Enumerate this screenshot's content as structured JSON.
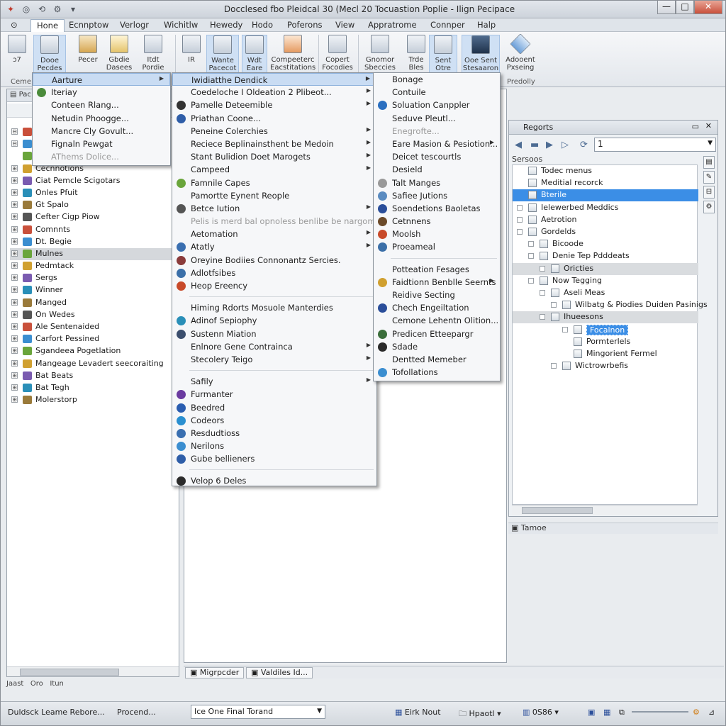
{
  "window": {
    "title": "Docclesed fbo Pleidcal 30 (Mecl 20 Tocuastion Poplie - Ilign Pecipace",
    "controls": {
      "minimize": "—",
      "maximize": "□",
      "close": "✕"
    }
  },
  "quick_access": [
    "◐",
    "◎",
    "⟲",
    "⚙",
    "▾"
  ],
  "menubar": {
    "tabs": [
      "Hone",
      "Ecnnptow",
      "Verlogr",
      "Wichitlw",
      "Hewedy",
      "Hodo",
      "Poferons",
      "View",
      "Appratrome",
      "Connper",
      "Halp"
    ],
    "active_index": 0
  },
  "ribbon": {
    "buttons": [
      {
        "label": "ɔ7",
        "icon": "paste-icon"
      },
      {
        "label": "Dooe Pecdes",
        "icon": "document-icon"
      },
      {
        "label": "Pecer",
        "icon": "database-icon"
      },
      {
        "label": "Gbdie Dasees",
        "icon": "triangle-icon"
      },
      {
        "label": "Itdt Pordie",
        "icon": "grid-icon"
      },
      {
        "label": "IR",
        "icon": "ruler-icon"
      },
      {
        "label": "Wante Pacecot",
        "icon": "page-icon"
      },
      {
        "label": "Wdt Eare",
        "icon": "camera-icon"
      },
      {
        "label": "Compeeterc Eacstitations",
        "icon": "stack-icon"
      },
      {
        "label": "Copert Focodies",
        "icon": "export-icon"
      },
      {
        "label": "Gnomor Sbeccies",
        "icon": "pen-icon"
      },
      {
        "label": "Trde Bles",
        "icon": "tools-icon"
      },
      {
        "label": "Sent Otre",
        "icon": "sheet-icon"
      },
      {
        "label": "Ooe Sent Stesaaron",
        "icon": "monitor-icon"
      },
      {
        "label": "Adooent Pxseing",
        "icon": "diamond-icon"
      }
    ],
    "groups": [
      "Ceme",
      "Predolly"
    ]
  },
  "left_pane": {
    "header": "Pac",
    "tree": [
      {
        "label": "Mancre Cly Govult...",
        "exp": "⊟"
      },
      {
        "label": "Fignaln Pewgat",
        "exp": "⊟"
      },
      {
        "label": "AThems Dolice...",
        "exp": ""
      },
      {
        "label": "Cecnnotions",
        "exp": "⊞"
      },
      {
        "label": "Ciat Pemcle Scigotars",
        "exp": "⊞"
      },
      {
        "label": "Onles Pfuit",
        "exp": "⊞"
      },
      {
        "label": "Gt Spalo",
        "exp": "⊞"
      },
      {
        "label": "Cefter Cigp Piow",
        "exp": "⊞"
      },
      {
        "label": "Comnnts",
        "exp": "⊞"
      },
      {
        "label": "Dt. Begie",
        "exp": "⊞"
      },
      {
        "label": "Mulnes",
        "exp": "⊞",
        "selected": true
      },
      {
        "label": "Pedmtack",
        "exp": "⊞"
      },
      {
        "label": "Sergs",
        "exp": "⊞"
      },
      {
        "label": "Winner",
        "exp": "⊞"
      },
      {
        "label": "Manged",
        "exp": "⊞"
      },
      {
        "label": "On Wedes",
        "exp": "⊞"
      },
      {
        "label": "Ale Sentenaided",
        "exp": "⊞"
      },
      {
        "label": "Carfort Pessined",
        "exp": "⊞"
      },
      {
        "label": "Sgandeea Pogetlation",
        "exp": "⊞"
      },
      {
        "label": "Mangeage Levadert seecoraiting",
        "exp": "⊞"
      },
      {
        "label": "Bat Beats",
        "exp": "⊞"
      },
      {
        "label": "Bat Tegh",
        "exp": "⊞"
      },
      {
        "label": "Molerstorp",
        "exp": "⊞"
      }
    ]
  },
  "menu1": {
    "items": [
      {
        "label": "Aarture",
        "arrow": true,
        "highlight": true
      },
      {
        "label": "Iteriay",
        "icon_color": "#4b8b3b"
      },
      {
        "label": "Conteen Rlang..."
      },
      {
        "label": "Netudin Phoogge..."
      },
      {
        "label": "Mancre Cly Govult..."
      },
      {
        "label": "Fignaln Pewgat"
      },
      {
        "label": "AThems Dolice...",
        "disabled": true
      }
    ]
  },
  "menu2": {
    "items": [
      {
        "label": "Iwidiatthe Dendick",
        "arrow": true,
        "highlight": true
      },
      {
        "label": "Coedeloche I Oldeation 2 Plibeot...",
        "arrow": true
      },
      {
        "label": "Pamelle Deteemible",
        "arrow": true,
        "icon_color": "#333"
      },
      {
        "label": "Priathan Coone...",
        "icon_color": "#2f5ea8"
      },
      {
        "label": "Peneine Colerchies",
        "arrow": true
      },
      {
        "label": "Reciece Beplinainsthent be Medoin",
        "arrow": true
      },
      {
        "label": "Stant Bulidion Doet Marogets",
        "arrow": true
      },
      {
        "label": "Campeed",
        "arrow": true
      },
      {
        "label": "Famnile Capes",
        "icon_color": "#6aa53b"
      },
      {
        "label": "Pamortte Eynent Reople"
      },
      {
        "label": "Betce Iution",
        "arrow": true,
        "icon_color": "#555"
      },
      {
        "label": "Pelis is merd bal opnoless benlibe be nargomed",
        "disabled": true
      },
      {
        "label": "Aetomation",
        "arrow": true
      },
      {
        "label": "Atatly",
        "arrow": true,
        "icon_color": "#3a6fb0"
      },
      {
        "label": "Oreyine Bodiies Connonantz Sercies.",
        "icon_color": "#8a3b3b"
      },
      {
        "label": "Adlotfsibes",
        "icon_color": "#3b6fa8"
      },
      {
        "label": "Heop Ereency",
        "icon_color": "#c84a2a"
      },
      {
        "sep": true
      },
      {
        "label": "Himing Rdorts Mosuole Manterdies"
      },
      {
        "label": "Adinof Sepiophy",
        "icon_color": "#2a8fb8"
      },
      {
        "label": "Sustenn Miation",
        "icon_color": "#3b4e6d"
      },
      {
        "label": "Enlnore Gene Contrainca",
        "arrow": true
      },
      {
        "label": "Stecolery Teigo",
        "arrow": true
      },
      {
        "sep": true
      },
      {
        "label": "Safily",
        "arrow": true
      },
      {
        "label": "Furmanter",
        "icon_color": "#6b3ba0"
      },
      {
        "label": "Beedred",
        "icon_color": "#2a5db0"
      },
      {
        "label": "Codeors",
        "icon_color": "#2a8fd0"
      },
      {
        "label": "Resdudtioss",
        "icon_color": "#3a6fb0"
      },
      {
        "label": "Nerilons",
        "icon_color": "#3b8ed0"
      },
      {
        "label": "Gube bellieners",
        "icon_color": "#2f5ea8"
      },
      {
        "sep": true
      },
      {
        "label": "Velop 6 Deles",
        "icon_color": "#2b2b2b"
      }
    ]
  },
  "menu3": {
    "items": [
      {
        "label": "Bonage"
      },
      {
        "label": "Contuile"
      },
      {
        "label": "Soluation Canppler",
        "icon_color": "#2a6fc0"
      },
      {
        "label": "Seduve Pleutl..."
      },
      {
        "label": "Enegrofte...",
        "disabled": true
      },
      {
        "label": "Eare Masion & Pesiotion...",
        "arrow": true
      },
      {
        "label": "Deicet tescourtls"
      },
      {
        "label": "Desield"
      },
      {
        "label": "Talt Manges",
        "icon_color": "#999"
      },
      {
        "label": "Safiee Jutions",
        "icon_color": "#5a8bc0"
      },
      {
        "label": "Soendetions Baoletas",
        "icon_color": "#2a4e9a"
      },
      {
        "label": "Cetnnens",
        "icon_color": "#6b4a2a"
      },
      {
        "label": "Moolsh",
        "icon_color": "#c84a2a"
      },
      {
        "label": "Proeameal",
        "icon_color": "#3b6fa8"
      },
      {
        "sep": true
      },
      {
        "label": "Potteation Fesages"
      },
      {
        "label": "Faidtionn Benblle Seernts",
        "arrow": true,
        "icon_color": "#d0a030"
      },
      {
        "label": "Reidive Secting"
      },
      {
        "label": "Chech Engeiltation",
        "icon_color": "#2a4e9a"
      },
      {
        "label": "Cemone Lehentn Olition..."
      },
      {
        "label": "Predicen Etteepargr",
        "icon_color": "#3b6e3b"
      },
      {
        "label": "Sdade",
        "icon_color": "#2a2a2a"
      },
      {
        "label": "Dentted Memeber"
      },
      {
        "label": "Tofollations",
        "icon_color": "#3b8ed0"
      }
    ]
  },
  "right_pane": {
    "title": "Regorts",
    "nav_value": "1",
    "section": "Sersoos",
    "rows": [
      {
        "label": "Todec menus",
        "indent": 0,
        "exp": false,
        "style": ""
      },
      {
        "label": "Meditial recorck",
        "indent": 0,
        "exp": false,
        "style": ""
      },
      {
        "label": "Bterile",
        "indent": 0,
        "exp": false,
        "style": "blue"
      },
      {
        "label": "Ielewerbed Meddics",
        "indent": 0,
        "exp": true,
        "style": ""
      },
      {
        "label": "Aetrotion",
        "indent": 0,
        "exp": true,
        "style": ""
      },
      {
        "label": "Gordelds",
        "indent": 0,
        "exp": true,
        "style": ""
      },
      {
        "label": "Bicoode",
        "indent": 1,
        "exp": true,
        "style": ""
      },
      {
        "label": "Denie Tep Pdddeats",
        "indent": 1,
        "exp": true,
        "style": ""
      },
      {
        "label": "Oricties",
        "indent": 2,
        "exp": true,
        "style": "gray"
      },
      {
        "label": "Now Tegging",
        "indent": 1,
        "exp": true,
        "style": ""
      },
      {
        "label": "Aseli Meas",
        "indent": 2,
        "exp": true,
        "style": ""
      },
      {
        "label": "Wilbatg & Piodies Duiden Pasinigs",
        "indent": 3,
        "exp": true,
        "style": ""
      },
      {
        "label": "Ihueesons",
        "indent": 2,
        "exp": true,
        "style": "gray"
      },
      {
        "label": "Focalnon",
        "indent": 4,
        "exp": true,
        "style": "blue-sel"
      },
      {
        "label": "Pormterlels",
        "indent": 4,
        "exp": false,
        "style": ""
      },
      {
        "label": "Mingorient Fermel",
        "indent": 4,
        "exp": false,
        "style": ""
      },
      {
        "label": "Wictrowrbefis",
        "indent": 3,
        "exp": true,
        "style": ""
      }
    ],
    "footer": "Tamoe"
  },
  "bottom_tabs": [
    "Migrpcder",
    "Valdiles Id..."
  ],
  "status_line": [
    "Jaast",
    "Oro",
    "Itun"
  ],
  "statusbar": {
    "left": "Duldsck Leame Rebore...",
    "middle": "Procend...",
    "combo_value": "Ice One Final Torand",
    "items": [
      "Eirk Nout",
      "Hpaotl",
      "0S86"
    ]
  }
}
